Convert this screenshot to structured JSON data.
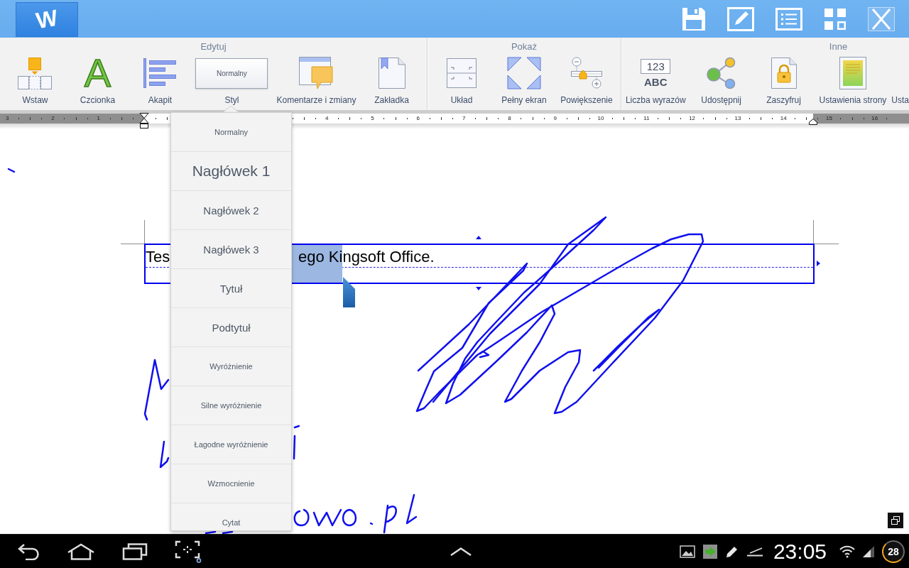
{
  "title_bar": {
    "logo": "W"
  },
  "ribbon": {
    "groups": [
      {
        "title": "Edytuj",
        "items": [
          {
            "label": "Wstaw",
            "kind": "insert"
          },
          {
            "label": "Czcionka",
            "kind": "font",
            "glyph": "A"
          },
          {
            "label": "Akapit",
            "kind": "paragraph"
          },
          {
            "label": "Styl",
            "kind": "style",
            "preview": "Normalny"
          },
          {
            "label": "Komentarze i zmiany",
            "kind": "comments"
          },
          {
            "label": "Zakładka",
            "kind": "bookmark"
          }
        ]
      },
      {
        "title": "Pokaż",
        "items": [
          {
            "label": "Układ",
            "kind": "layout"
          },
          {
            "label": "Pełny ekran",
            "kind": "fullscreen"
          },
          {
            "label": "Powiększenie",
            "kind": "zoom"
          }
        ]
      },
      {
        "title": "Inne",
        "items": [
          {
            "label": "Liczba wyrazów",
            "kind": "wordcount",
            "icon_digits": "123",
            "icon_letters": "ABC"
          },
          {
            "label": "Udostępnij",
            "kind": "share"
          },
          {
            "label": "Zaszyfruj",
            "kind": "encrypt"
          },
          {
            "label": "Ustawienia strony",
            "kind": "pagesetup"
          },
          {
            "label": "Usta",
            "kind": "clipped"
          }
        ]
      }
    ]
  },
  "ruler": {
    "left_numbers": [
      "3",
      "2",
      "1"
    ],
    "numbers": [
      "4",
      "5",
      "6",
      "7",
      "8",
      "9",
      "10",
      "11",
      "12",
      "13",
      "14",
      "15",
      "16"
    ]
  },
  "document": {
    "text_runs": [
      {
        "text": "Tes",
        "selected": false
      },
      {
        "text": "ego Ki",
        "selected": true
      },
      {
        "text": "ngsoft Office.",
        "selected": false
      }
    ]
  },
  "style_menu": {
    "items": [
      {
        "label": "Normalny",
        "kind": "small"
      },
      {
        "label": "Nagłówek 1",
        "kind": "large"
      },
      {
        "label": "Nagłówek 2",
        "kind": "medium"
      },
      {
        "label": "Nagłówek 3",
        "kind": "medium"
      },
      {
        "label": "Tytuł",
        "kind": "medium"
      },
      {
        "label": "Podtytuł",
        "kind": "medium"
      },
      {
        "label": "Wyróżnienie",
        "kind": "small"
      },
      {
        "label": "Silne wyróżnienie",
        "kind": "small"
      },
      {
        "label": "Łagodne wyróżnienie",
        "kind": "small"
      },
      {
        "label": "Wzmocnienie",
        "kind": "small"
      },
      {
        "label": "Cytat",
        "kind": "small"
      }
    ]
  },
  "status_bar": {
    "time": "23:05",
    "battery": "28"
  }
}
